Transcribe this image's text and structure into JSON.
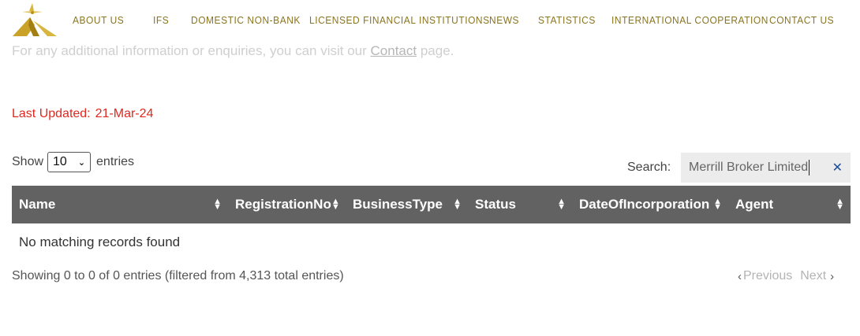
{
  "nav": {
    "items": [
      {
        "label": "ABOUT US",
        "name": "nav-about-us"
      },
      {
        "label": "IFS",
        "name": "nav-ifs"
      },
      {
        "label": "DOMESTIC NON-BANK",
        "name": "nav-domestic-non-bank"
      },
      {
        "label": "LICENSED FINANCIAL INSTITUTIONS",
        "name": "nav-licensed-financial-institutions"
      },
      {
        "label": "NEWS",
        "name": "nav-news"
      },
      {
        "label": "STATISTICS",
        "name": "nav-statistics"
      },
      {
        "label": "INTERNATIONAL COOPERATION",
        "name": "nav-international-cooperation"
      },
      {
        "label": "CONTACT US",
        "name": "nav-contact-us"
      }
    ]
  },
  "intro": {
    "before": "For any additional information or enquiries, you can visit our ",
    "link": "Contact",
    "after": " page."
  },
  "updated": {
    "label": "Last Updated:",
    "date": "21-Mar-24"
  },
  "length": {
    "show": "Show",
    "value": "10",
    "entries": "entries"
  },
  "search": {
    "label": "Search:",
    "value": "Merrill Broker Limited",
    "clear": "✕"
  },
  "table": {
    "columns": [
      "Name",
      "RegistrationNo",
      "BusinessType",
      "Status",
      "DateOfIncorporation",
      "Agent"
    ],
    "empty": "No matching records found"
  },
  "info": "Showing 0 to 0 of 0 entries (filtered from 4,313 total entries)",
  "pager": {
    "prev": "Previous",
    "next": "Next"
  },
  "colors": {
    "nav": "#8a7420",
    "header_bg": "#626262",
    "updated": "#e0281f",
    "clear": "#1e4d9a"
  }
}
